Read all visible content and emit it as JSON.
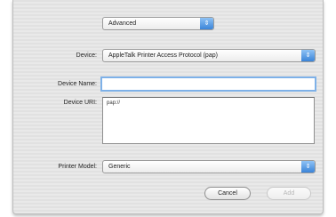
{
  "type_popup": {
    "value": "Advanced",
    "icon": "updown-arrows-icon"
  },
  "device": {
    "label": "Device:",
    "value": "AppleTalk Printer Access Protocol (pap)"
  },
  "device_name": {
    "label": "Device Name:",
    "value": ""
  },
  "device_uri": {
    "label": "Device URI:",
    "value": "pap://"
  },
  "printer_model": {
    "label": "Printer Model:",
    "value": "Generic"
  },
  "buttons": {
    "cancel": "Cancel",
    "add": "Add"
  },
  "colors": {
    "accent": "#3a84d8",
    "focus": "#7eb1e8"
  }
}
